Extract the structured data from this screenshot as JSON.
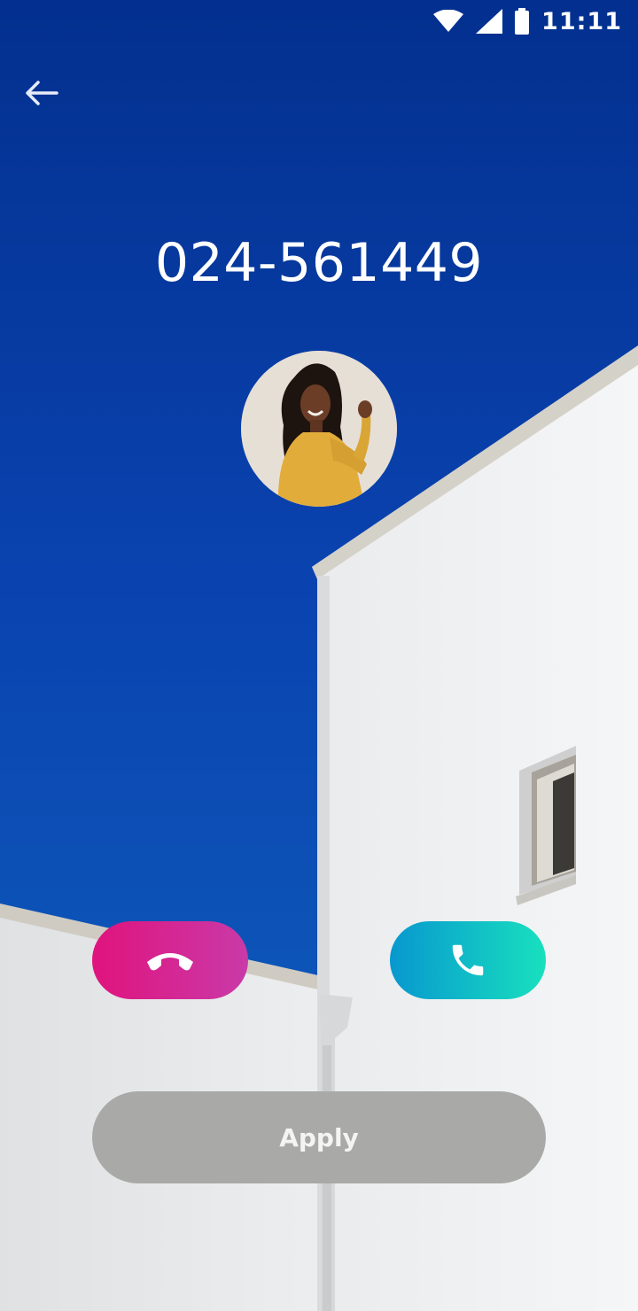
{
  "status_bar": {
    "time": "11:11",
    "icons": [
      "wifi-icon",
      "cellular-signal-icon",
      "battery-icon"
    ]
  },
  "call": {
    "caller_number": "024-561449",
    "avatar": "caller-avatar-photo"
  },
  "actions": {
    "decline_icon": "phone-hangup-icon",
    "accept_icon": "phone-icon",
    "apply_label": "Apply"
  },
  "colors": {
    "decline_gradient": [
      "#e0137d",
      "#c93aa8"
    ],
    "accept_gradient": [
      "#0898cf",
      "#18e0be"
    ],
    "apply_background": "#a9a9a7",
    "sky": "#0a43b0"
  }
}
